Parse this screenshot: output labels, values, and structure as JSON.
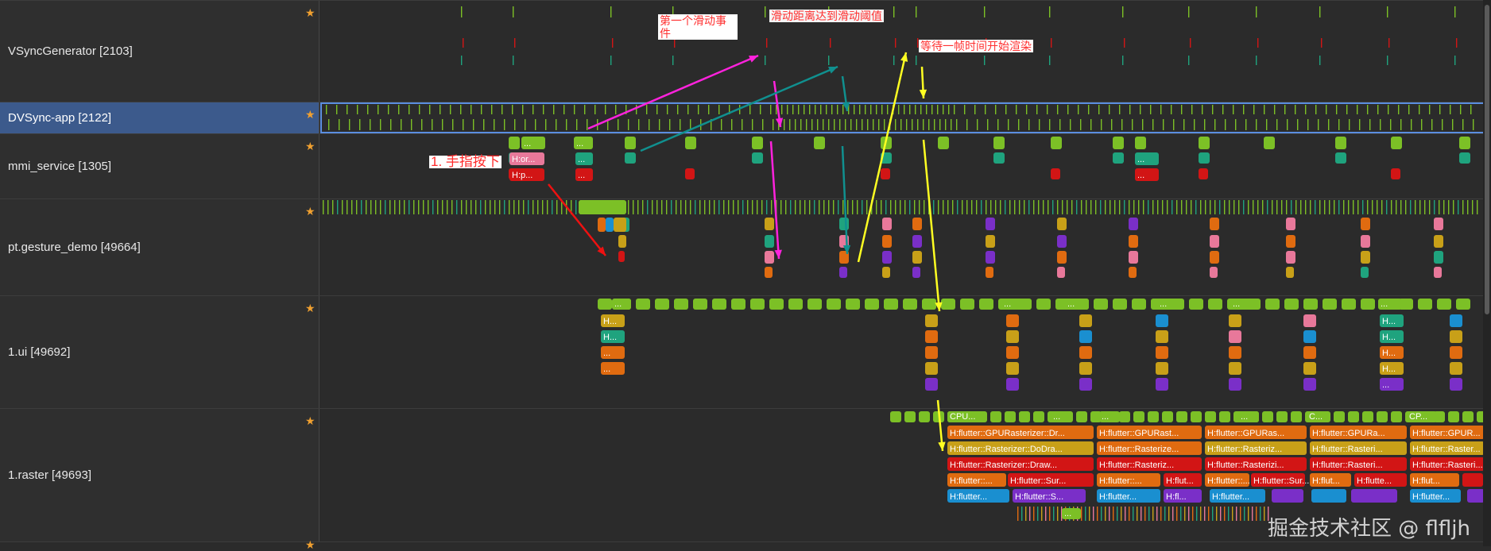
{
  "lanes": [
    {
      "label": "VSyncGenerator [2103]"
    },
    {
      "label": "DVSync-app [2122]"
    },
    {
      "label": "mmi_service [1305]"
    },
    {
      "label": "pt.gesture_demo [49664]"
    },
    {
      "label": "1.ui [49692]"
    },
    {
      "label": "1.raster [49693]"
    }
  ],
  "star_icon": "★",
  "annotations": {
    "first_event": "第一个滑动事件",
    "threshold": "滑动距离达到滑动阈值",
    "wait_frame": "等待一帧时间开始渲染",
    "finger_down": "1. 手指按下"
  },
  "slice_labels": {
    "mmi_h1": "H:or...",
    "mmi_h2": "H:p...",
    "ellipsis": "...",
    "ui_h": "H...",
    "cpu": "CPU...",
    "cpu_short": "C...",
    "cpu_p": "CP...",
    "raster_r1_a": "H:flutter::GPURasterizer::Dr...",
    "raster_r1_b": "H:flutter::GPURast...",
    "raster_r1_c": "H:flutter::GPURas...",
    "raster_r1_d": "H:flutter::GPURa...",
    "raster_r1_e": "H:flutter::GPUR...",
    "raster_r2_a": "H:flutter::Rasterizer::DoDra...",
    "raster_r2_b": "H:flutter::Rasterize...",
    "raster_r2_c": "H:flutter::Rasteriz...",
    "raster_r2_d": "H:flutter::Rasteri...",
    "raster_r2_e": "H:flutter::Raster...",
    "raster_r3_a": "H:flutter::Rasterizer::Draw...",
    "raster_r3_b": "H:flutter::Rasteriz...",
    "raster_r3_c": "H:flutter::Rasterizi...",
    "raster_r3_d": "H:flutter::Rasteri...",
    "raster_r3_e": "H:flutter::Rasteri...",
    "raster_r4_a": "H:flutter::...",
    "raster_r4_b": "H:flutter::Sur...",
    "raster_r4_c": "H:flutter::...",
    "raster_r4_d": "H:flut...",
    "raster_r4_e": "H:flutte...",
    "raster_r5_a": "H:flutter...",
    "raster_r5_b": "H:flutter::S...",
    "raster_r5_c": "H:flutter...",
    "raster_r5_d": "H:fl...",
    "raster_r5_e": "H:flutter..."
  },
  "colors": {
    "green": "#7cc026",
    "teal": "#1fa37e",
    "red": "#d21515",
    "pink": "#e8789a",
    "orange": "#e06b10",
    "gold": "#c8a018",
    "purple": "#7a2fc8",
    "blue": "#1a8fd0",
    "magenta_arrow": "#ff22dd",
    "teal_arrow": "#10908f",
    "yellow_arrow": "#ffff22",
    "red_arrow": "#ee1111"
  },
  "watermark": "掘金技术社区 @ flfljh"
}
